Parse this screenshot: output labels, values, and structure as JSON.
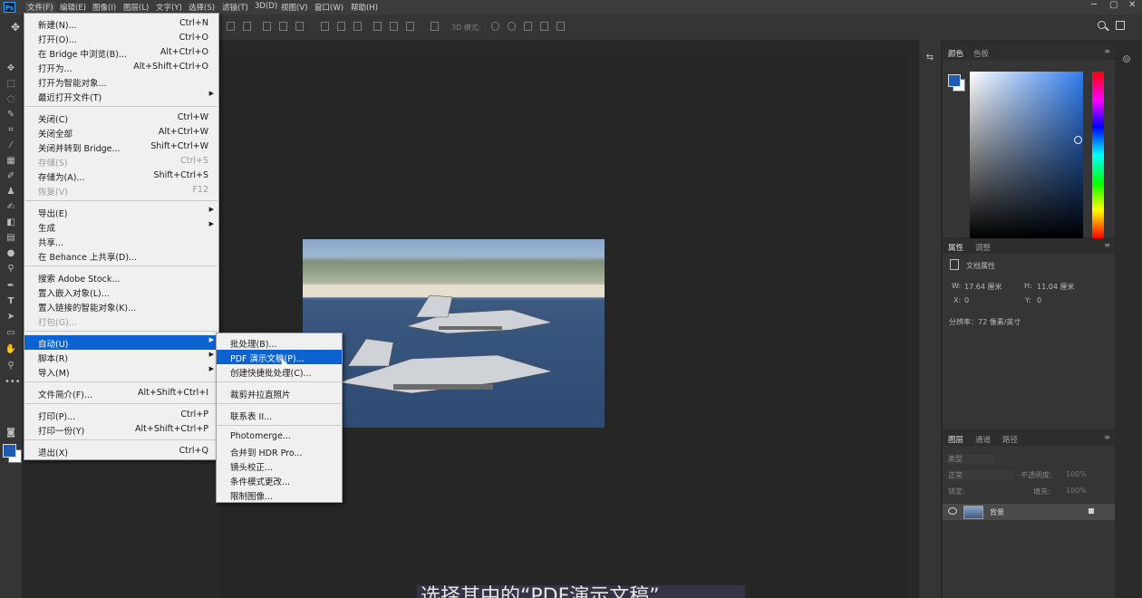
{
  "app": {
    "logo": "Ps",
    "menubar": [
      "文件(F)",
      "编辑(E)",
      "图像(I)",
      "图层(L)",
      "文字(Y)",
      "选择(S)",
      "滤镜(T)",
      "3D(D)",
      "视图(V)",
      "窗口(W)",
      "帮助(H)"
    ],
    "window_controls": [
      "─",
      "▢",
      "✕"
    ]
  },
  "options_bar": {
    "mode_3d": "3D 模式:"
  },
  "file_menu": {
    "items": [
      {
        "label": "新建(N)...",
        "shortcut": "Ctrl+N"
      },
      {
        "label": "打开(O)...",
        "shortcut": "Ctrl+O"
      },
      {
        "label": "在 Bridge 中浏览(B)...",
        "shortcut": "Alt+Ctrl+O"
      },
      {
        "label": "打开为...",
        "shortcut": "Alt+Shift+Ctrl+O"
      },
      {
        "label": "打开为智能对象...",
        "shortcut": ""
      },
      {
        "label": "最近打开文件(T)",
        "shortcut": ""
      },
      {
        "label": "关闭(C)",
        "shortcut": "Ctrl+W"
      },
      {
        "label": "关闭全部",
        "shortcut": "Alt+Ctrl+W"
      },
      {
        "label": "关闭并转到 Bridge...",
        "shortcut": "Shift+Ctrl+W"
      },
      {
        "label": "存储(S)",
        "shortcut": "Ctrl+S"
      },
      {
        "label": "存储为(A)...",
        "shortcut": "Shift+Ctrl+S"
      },
      {
        "label": "恢复(V)",
        "shortcut": "F12"
      },
      {
        "label": "导出(E)",
        "shortcut": ""
      },
      {
        "label": "生成",
        "shortcut": ""
      },
      {
        "label": "共享...",
        "shortcut": ""
      },
      {
        "label": "在 Behance 上共享(D)...",
        "shortcut": ""
      },
      {
        "label": "搜索 Adobe Stock...",
        "shortcut": ""
      },
      {
        "label": "置入嵌入对象(L)...",
        "shortcut": ""
      },
      {
        "label": "置入链接的智能对象(K)...",
        "shortcut": ""
      },
      {
        "label": "打包(G)...",
        "shortcut": ""
      },
      {
        "label": "自动(U)",
        "shortcut": ""
      },
      {
        "label": "脚本(R)",
        "shortcut": ""
      },
      {
        "label": "导入(M)",
        "shortcut": ""
      },
      {
        "label": "文件简介(F)...",
        "shortcut": "Alt+Shift+Ctrl+I"
      },
      {
        "label": "打印(P)...",
        "shortcut": "Ctrl+P"
      },
      {
        "label": "打印一份(Y)",
        "shortcut": "Alt+Shift+Ctrl+P"
      },
      {
        "label": "退出(X)",
        "shortcut": "Ctrl+Q"
      }
    ]
  },
  "automate_submenu": {
    "items": [
      "批处理(B)...",
      "PDF 演示文稿(P)...",
      "创建快捷批处理(C)...",
      "裁剪并拉直照片",
      "联系表 II...",
      "Photomerge...",
      "合并到 HDR Pro...",
      "镜头校正...",
      "条件模式更改...",
      "限制图像..."
    ]
  },
  "color_panel": {
    "tabs": [
      "颜色",
      "色板"
    ],
    "fg_color": "#1e5bb2",
    "bg_color": "#ffffff"
  },
  "properties_panel": {
    "tabs": [
      "属性",
      "调整"
    ],
    "title": "文档属性",
    "w_label": "W:",
    "w_value": "17.64 厘米",
    "h_label": "H:",
    "h_value": "11.04 厘米",
    "x_label": "X:",
    "x_value": "0",
    "y_label": "Y:",
    "y_value": "0",
    "resolution": "分辨率：72 像素/英寸"
  },
  "layers_panel": {
    "tabs": [
      "图层",
      "通道",
      "路径"
    ],
    "filter_placeholder": "类型",
    "blend_mode": "正常",
    "opacity_label": "不透明度:",
    "opacity_value": "100%",
    "lock_label": "锁定:",
    "fill_label": "填充:",
    "fill_value": "100%",
    "layer_name": "背景"
  },
  "caption": "选择其中的“PDF演示文稿”"
}
